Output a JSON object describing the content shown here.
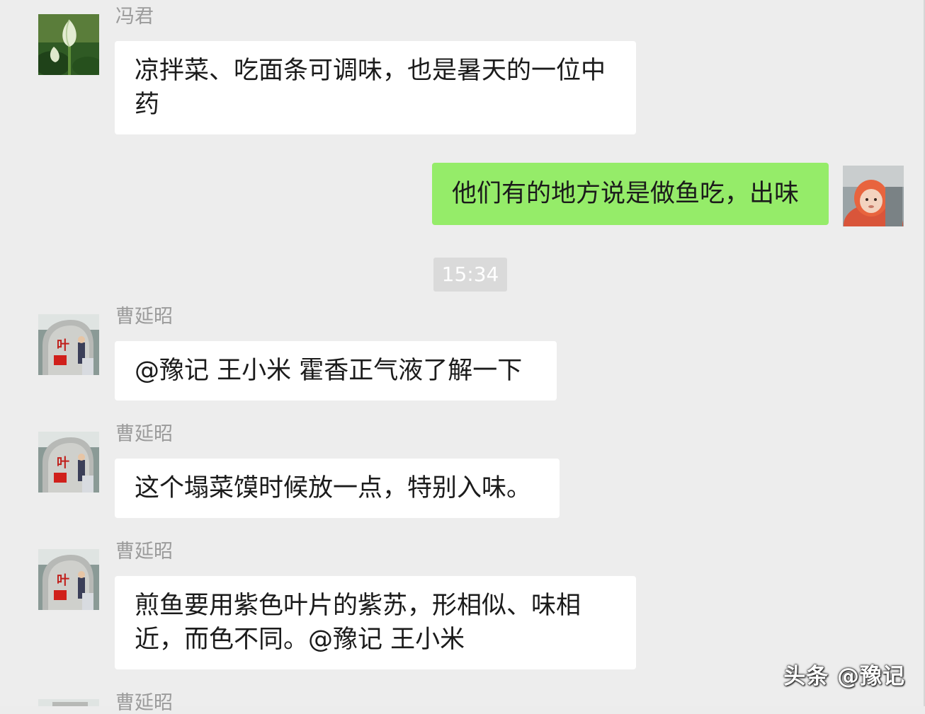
{
  "messages": [
    {
      "sender": "冯君",
      "text": "凉拌菜、吃面条可调味，也是暑天的一位中药",
      "avatar_icon": "lotus-bud-icon",
      "direction": "incoming"
    },
    {
      "text": "他们有的地方说是做鱼吃，出味",
      "avatar_icon": "baby-photo-icon",
      "direction": "outgoing"
    },
    {
      "sender": "曹延昭",
      "text": "@豫记 王小米  霍香正气液了解一下",
      "avatar_icon": "monument-photo-icon",
      "direction": "incoming"
    },
    {
      "sender": "曹延昭",
      "text": "这个塌菜馍时候放一点，特别入味。",
      "avatar_icon": "monument-photo-icon",
      "direction": "incoming"
    },
    {
      "sender": "曹延昭",
      "text": "煎鱼要用紫色叶片的紫苏，形相似、味相近，而色不同。@豫记 王小米",
      "avatar_icon": "monument-photo-icon",
      "direction": "incoming"
    },
    {
      "sender": "曹延昭",
      "avatar_icon": "monument-photo-icon",
      "direction": "incoming"
    }
  ],
  "timestamp": "15:34",
  "watermark": "头条 @豫记",
  "colors": {
    "background": "#ededed",
    "incoming_bubble": "#ffffff",
    "outgoing_bubble": "#95ec69",
    "sender_name": "#9b9b9b",
    "timestamp_badge": "#dadada"
  }
}
